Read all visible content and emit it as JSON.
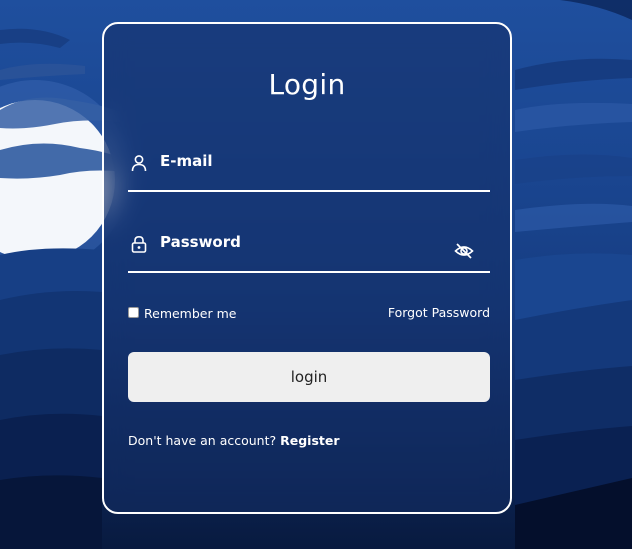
{
  "form": {
    "title": "Login",
    "email_label": "E-mail",
    "password_label": "Password",
    "remember_label": "Remember me",
    "forgot_label": "Forgot Password",
    "login_button": "login",
    "register_prompt": "Don't have an account?",
    "register_link": "Register"
  },
  "icons": {
    "email": "user-icon",
    "password": "lock-icon",
    "visibility": "eye-off-icon"
  },
  "colors": {
    "background_top": "#1f4f9e",
    "background_bottom": "#081a3f",
    "card_border": "#ffffff",
    "text": "#ffffff",
    "button_bg": "#efefef"
  }
}
